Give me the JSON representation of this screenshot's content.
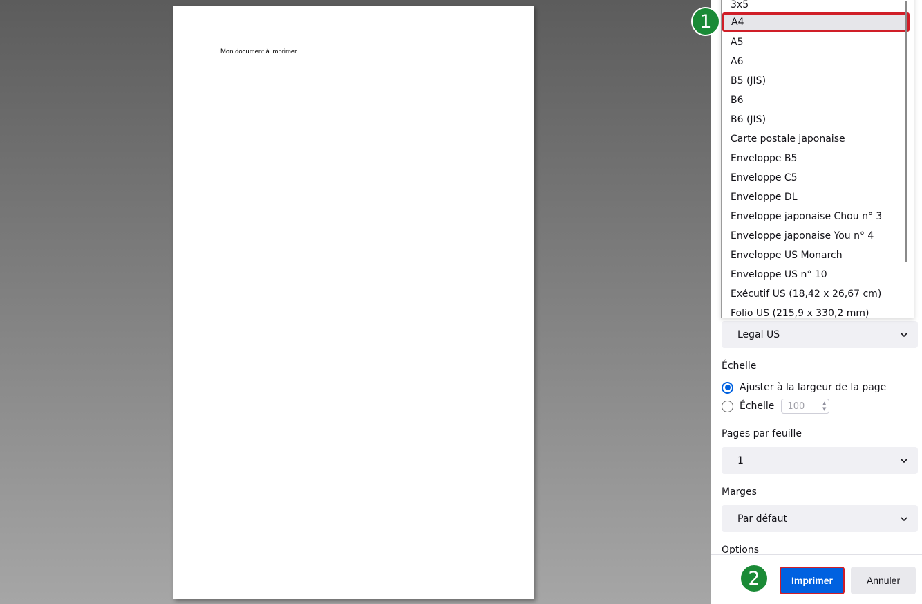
{
  "preview": {
    "document_text": "Mon document à imprimer."
  },
  "panel": {
    "paper_size_selected": "Legal US",
    "scale": {
      "label": "Échelle",
      "fit_option": "Ajuster à la largeur de la page",
      "custom_option": "Échelle",
      "custom_value": "100"
    },
    "pages_per_sheet": {
      "label": "Pages par feuille",
      "value": "1"
    },
    "margins": {
      "label": "Marges",
      "value": "Par défaut"
    },
    "options_label": "Options",
    "print_button": "Imprimer",
    "cancel_button": "Annuler"
  },
  "dropdown": {
    "items": [
      "3x5",
      "A4",
      "A5",
      "A6",
      "B5 (JIS)",
      "B6",
      "B6 (JIS)",
      "Carte postale japonaise",
      "Enveloppe B5",
      "Enveloppe C5",
      "Enveloppe DL",
      "Enveloppe japonaise Chou n° 3",
      "Enveloppe japonaise You n° 4",
      "Enveloppe US Monarch",
      "Enveloppe US n° 10",
      "Exécutif US (18,42 x 26,67 cm)",
      "Folio US (215,9 x 330,2 mm)"
    ],
    "highlighted": "A4"
  },
  "annotations": {
    "badge1": "1",
    "badge2": "2"
  },
  "colors": {
    "accent": "#0061e0",
    "highlight_border": "#d01e28",
    "badge": "#1a8a36"
  }
}
